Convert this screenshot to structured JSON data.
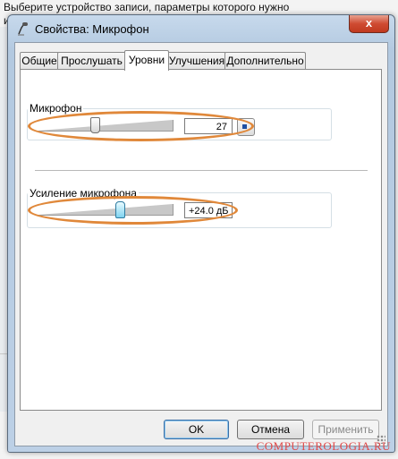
{
  "background_window": {
    "text": "Выберите устройство записи, параметры которого нужно\nиз"
  },
  "dialog": {
    "title": "Свойства: Микрофон",
    "close_label": "x"
  },
  "tabs": [
    {
      "label": "Общие",
      "active": false
    },
    {
      "label": "Прослушать",
      "active": false
    },
    {
      "label": "Уровни",
      "active": true
    },
    {
      "label": "Улучшения",
      "active": false
    },
    {
      "label": "Дополнительно",
      "active": false
    }
  ],
  "levels": {
    "microphone": {
      "label": "Микрофон",
      "value": "27",
      "level_fraction": 0.27
    },
    "boost": {
      "label": "Усиление микрофона",
      "value": "+24.0 дБ"
    }
  },
  "buttons": {
    "ok": "OK",
    "cancel": "Отмена",
    "apply": "Применить"
  },
  "watermark": "COMPUTEROLOGIA.RU",
  "colors": {
    "highlight": "#e0883a",
    "watermark": "#e04a4a"
  }
}
